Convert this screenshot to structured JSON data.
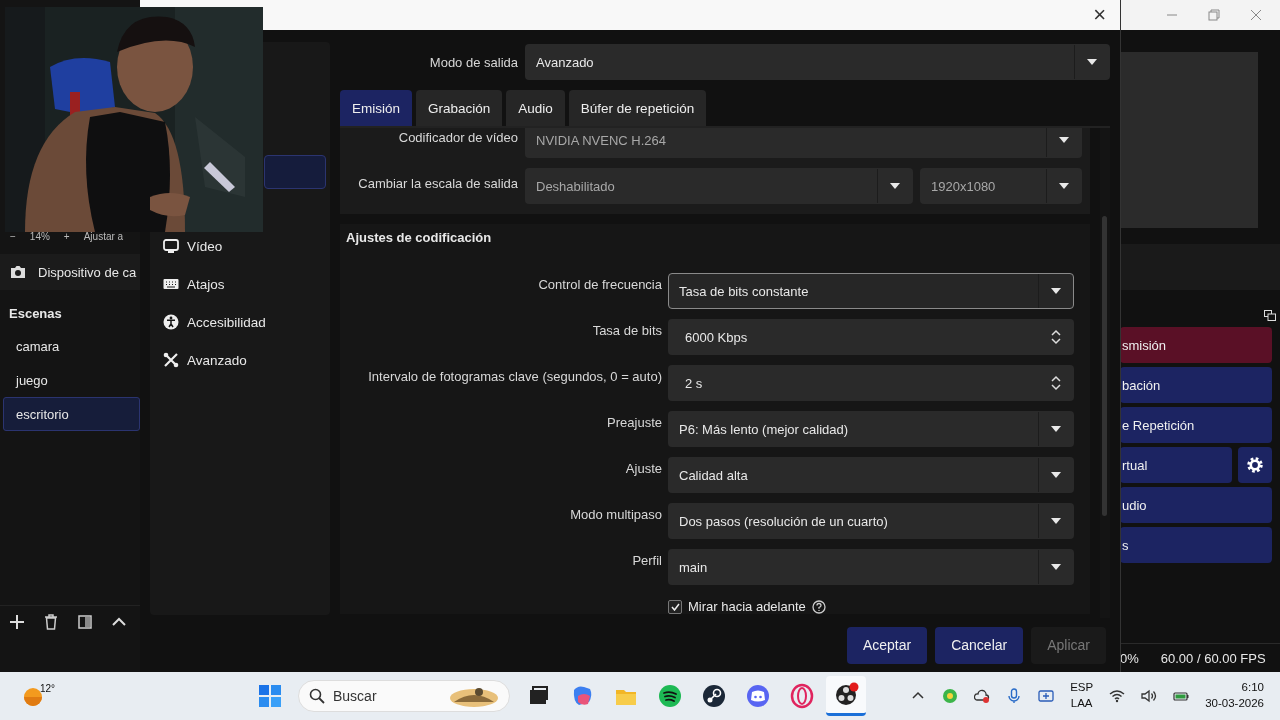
{
  "obs_window": {
    "zoom_bar": {
      "minus": "−",
      "zoom": "14%",
      "plus": "+",
      "fit": "Ajustar a"
    },
    "source": {
      "label": "Dispositivo de ca"
    },
    "scenes": {
      "title": "Escenas",
      "items": [
        {
          "label": "camara",
          "selected": false
        },
        {
          "label": "juego",
          "selected": false
        },
        {
          "label": "escritorio",
          "selected": true
        }
      ]
    },
    "controls": [
      {
        "label": "smisión",
        "color": "#5a1026",
        "settings_button": false
      },
      {
        "label": "bación",
        "color": "#1c2462",
        "settings_button": false
      },
      {
        "label": "e Repetición",
        "color": "#1c2462",
        "settings_button": false
      },
      {
        "label": "rtual",
        "color": "#1c2462",
        "settings_button": true
      },
      {
        "label": "udio",
        "color": "#1c2462",
        "settings_button": false
      },
      {
        "label": "s",
        "color": "#1c2462",
        "settings_button": false
      }
    ],
    "status_bar": {
      "cpu": "0%",
      "fps": "60.00 / 60.00 FPS"
    }
  },
  "settings_dialog": {
    "close": "×",
    "sidebar": {
      "items": [
        {
          "selected": true
        },
        {
          "label": "Vídeo",
          "selected": false,
          "kind": "video"
        },
        {
          "label": "Atajos",
          "selected": false,
          "kind": "hotkeys"
        },
        {
          "label": "Accesibilidad",
          "selected": false,
          "kind": "accessibility"
        },
        {
          "label": "Avanzado",
          "selected": false,
          "kind": "advanced"
        }
      ]
    },
    "output_mode": {
      "label": "Modo de salida",
      "value": "Avanzado"
    },
    "tabs": [
      {
        "label": "Emisión",
        "selected": true
      },
      {
        "label": "Grabación",
        "selected": false
      },
      {
        "label": "Audio",
        "selected": false
      },
      {
        "label": "Búfer de repetición",
        "selected": false
      }
    ],
    "encoder_group": [
      {
        "label": "Codificador de vídeo",
        "values": [
          "NVIDIA NVENC H.264"
        ],
        "disabled": true
      },
      {
        "label": "Cambiar la escala de salida",
        "values": [
          "Deshabilitado",
          "1920x1080"
        ],
        "disabled": true
      }
    ],
    "encoding_settings": {
      "title": "Ajustes de codificación",
      "rows": [
        {
          "label": "Control de frecuencia",
          "kind": "dropdown",
          "value": "Tasa de bits constante",
          "focused": true
        },
        {
          "label": "Tasa de bits",
          "kind": "spin",
          "value": "6000 Kbps",
          "focused": false
        },
        {
          "label": "Intervalo de fotogramas clave (segundos, 0 = auto)",
          "kind": "spin",
          "value": "2 s",
          "focused": false
        },
        {
          "label": "Preajuste",
          "kind": "dropdown",
          "value": "P6: Más lento (mejor calidad)",
          "focused": false
        },
        {
          "label": "Ajuste",
          "kind": "dropdown",
          "value": "Calidad alta",
          "focused": false
        },
        {
          "label": "Modo multipaso",
          "kind": "dropdown",
          "value": "Dos pasos (resolución de un cuarto)",
          "focused": false
        },
        {
          "label": "Perfil",
          "kind": "dropdown",
          "value": "main",
          "focused": false
        }
      ],
      "checkbox": {
        "label": "Mirar hacia adelante",
        "checked": true,
        "help": true
      }
    },
    "buttons": [
      {
        "label": "Aceptar",
        "disabled": false
      },
      {
        "label": "Cancelar",
        "disabled": false
      },
      {
        "label": "Aplicar",
        "disabled": true
      }
    ]
  },
  "taskbar": {
    "weather": {
      "temperature": "12°"
    },
    "search": {
      "placeholder": "Buscar"
    },
    "apps": [
      {
        "kind": "start",
        "selected": false
      },
      {
        "kind": "task_view",
        "selected": false
      },
      {
        "kind": "copilot",
        "selected": false
      },
      {
        "kind": "explorer",
        "selected": false
      },
      {
        "kind": "spotify",
        "selected": false
      },
      {
        "kind": "steam",
        "selected": false
      },
      {
        "kind": "discord",
        "selected": false
      },
      {
        "kind": "opera",
        "selected": false
      },
      {
        "kind": "obs",
        "selected": true
      }
    ],
    "language": {
      "layout": "ESP",
      "region": "LAA"
    },
    "clock": {
      "time": "6:10",
      "date": "30-03-2026"
    }
  }
}
